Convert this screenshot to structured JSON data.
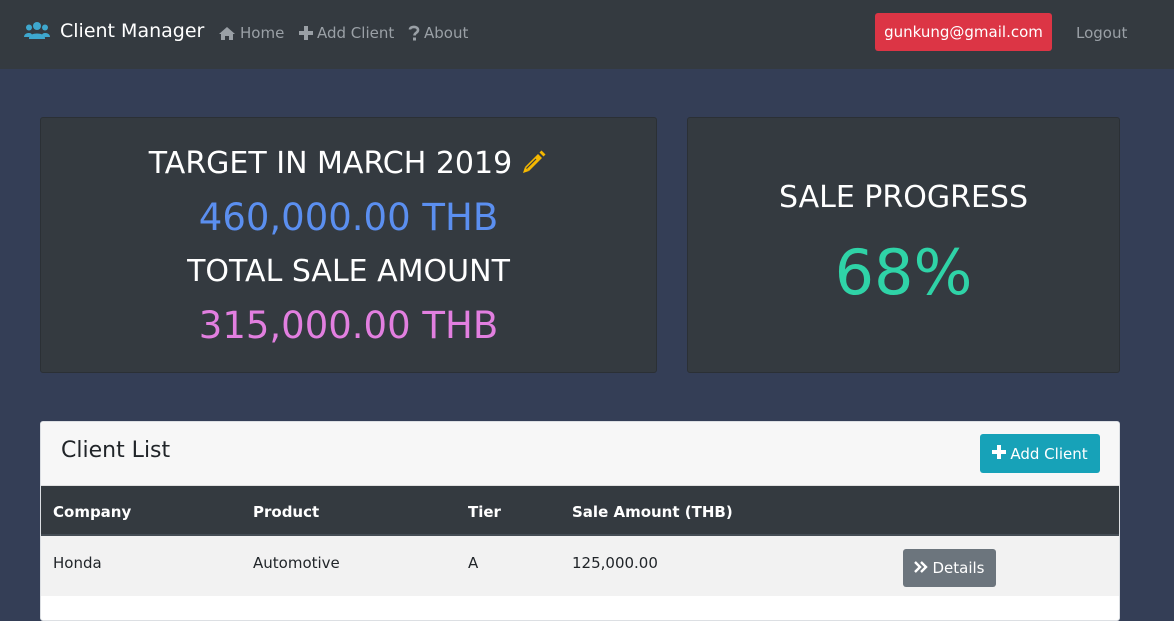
{
  "navbar": {
    "brand": "Client Manager",
    "links": [
      {
        "label": "Home",
        "icon": "home-icon"
      },
      {
        "label": "Add Client",
        "icon": "plus-icon"
      },
      {
        "label": "About",
        "icon": "question-icon"
      }
    ],
    "user_email": "gunkung@gmail.com",
    "logout_label": "Logout"
  },
  "target_card": {
    "target_label": "TARGET IN MARCH 2019",
    "target_amount": "460,000.00 THB",
    "total_label": "TOTAL SALE AMOUNT",
    "total_amount": "315,000.00 THB"
  },
  "progress_card": {
    "label": "SALE PROGRESS",
    "percent": "68%"
  },
  "client_list": {
    "title": "Client List",
    "add_button_label": "Add Client",
    "columns": [
      "Company",
      "Product",
      "Tier",
      "Sale Amount (THB)"
    ],
    "rows": [
      {
        "company": "Honda",
        "product": "Automotive",
        "tier": "A",
        "sale_amount": "125,000.00",
        "details_label": "Details"
      }
    ]
  },
  "colors": {
    "navbar_bg": "#343a40",
    "page_bg": "#343e56",
    "danger": "#dc3545",
    "info": "#17a2b8",
    "target_amount": "#5b8ff0",
    "total_amount": "#e27fe0",
    "progress": "#2fd3a7",
    "pencil": "#f5b800"
  }
}
